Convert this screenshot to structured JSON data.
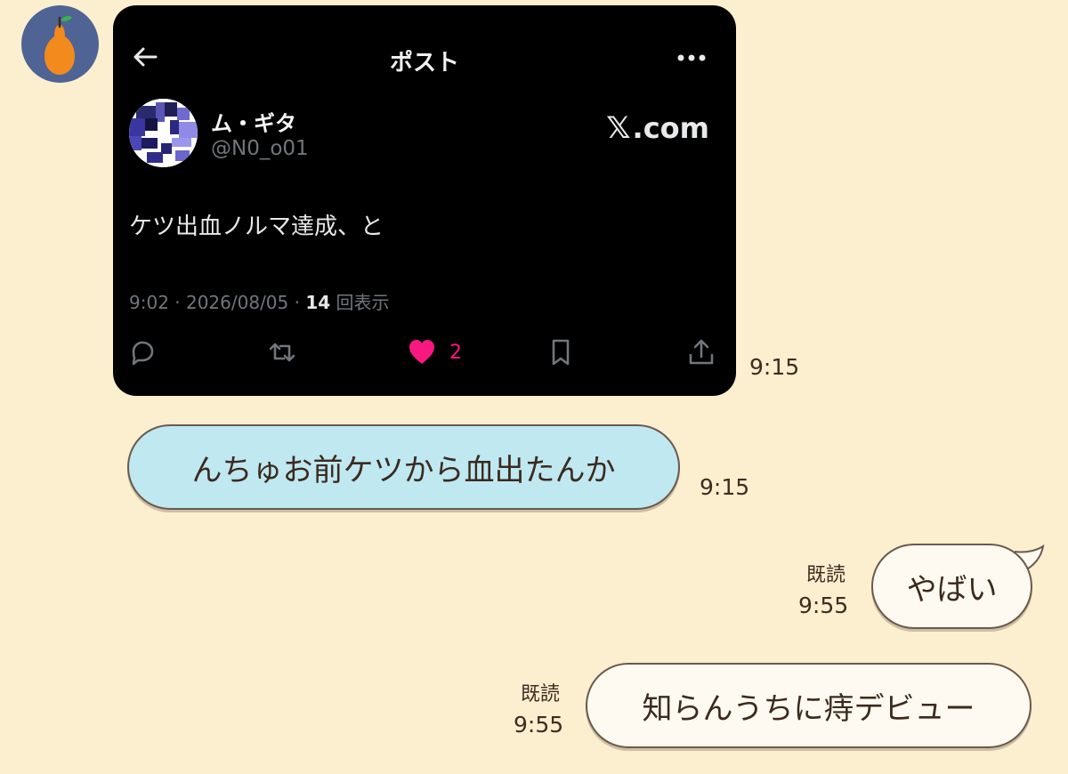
{
  "colors": {
    "background": "#fcefcf",
    "incoming_bubble": "#bfe8f1",
    "outgoing_bubble": "#fffaf1",
    "avatar_bg": "#4f6495",
    "like_pink": "#f91880",
    "post_card": "#000000"
  },
  "contact": {
    "avatar_icon": "pear-icon"
  },
  "messages": [
    {
      "type": "embedded-post",
      "time": "9:15",
      "post": {
        "header_title": "ポスト",
        "back_icon": "arrow-left-icon",
        "more_icon": "more-horizontal-icon",
        "display_name": "ム・ギタ",
        "handle": "@N0_o01",
        "source": "𝕏.com",
        "source_x": "𝕏",
        "source_domain": ".com",
        "text": "ケツ出血ノルマ達成、と",
        "timestamp": "9:02 · 2026/08/05 · ",
        "views_count": "14",
        "views_label": " 回表示",
        "like_count": "2",
        "action_icons": [
          "reply-icon",
          "retweet-icon",
          "heart-icon",
          "bookmark-icon",
          "share-icon"
        ]
      }
    },
    {
      "type": "incoming",
      "text": "んちゅお前ケツから血出たんか",
      "time": "9:15"
    },
    {
      "type": "outgoing",
      "text": "やばい",
      "read": "既読",
      "time": "9:55"
    },
    {
      "type": "outgoing",
      "text": "知らんうちに痔デビュー",
      "read": "既読",
      "time": "9:55"
    }
  ]
}
